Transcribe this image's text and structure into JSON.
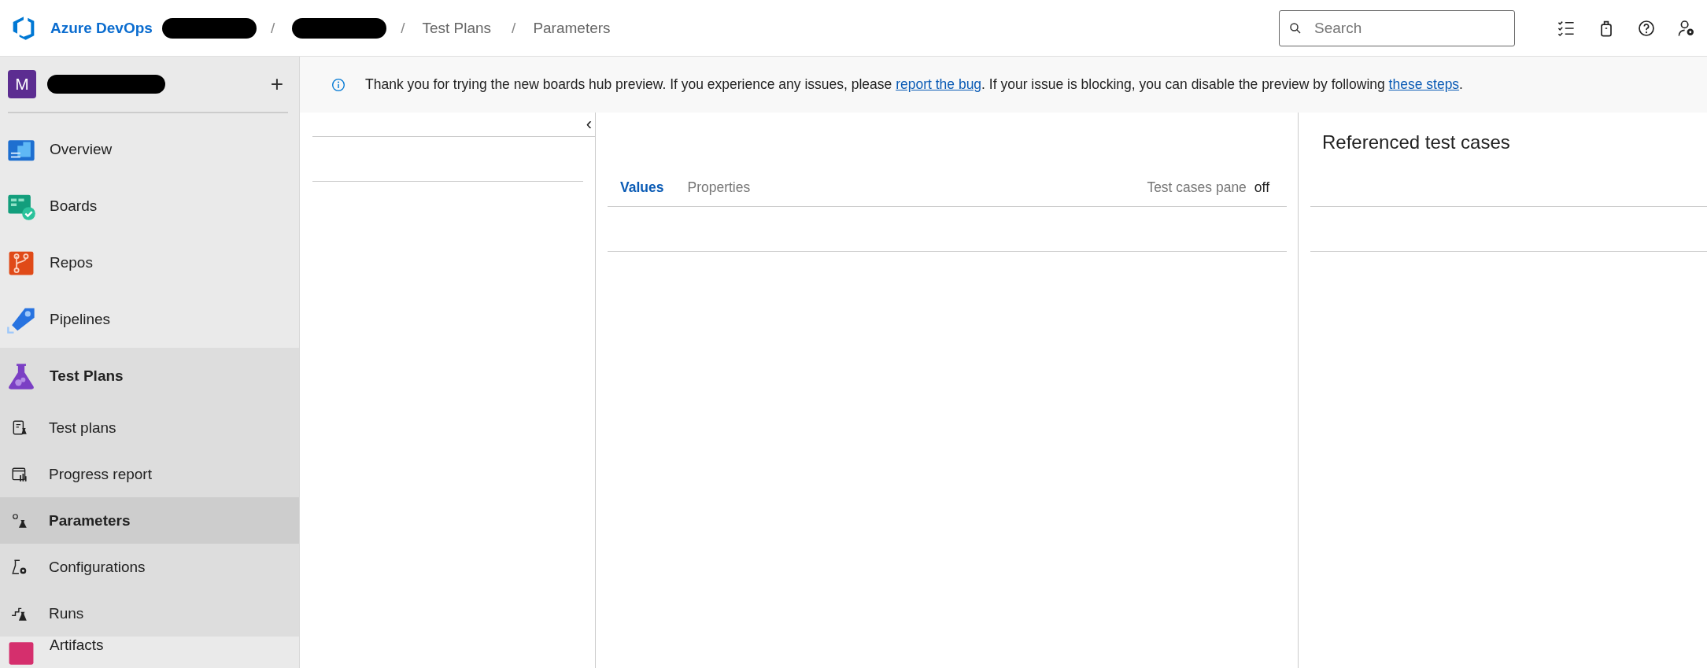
{
  "header": {
    "product": "Azure DevOps",
    "breadcrumbs": [
      {
        "kind": "redacted",
        "separator": "/"
      },
      {
        "kind": "redacted",
        "separator": "/"
      },
      {
        "kind": "text",
        "label": "Test Plans",
        "separator": "/"
      },
      {
        "kind": "text",
        "label": "Parameters"
      }
    ],
    "search": {
      "placeholder": "Search"
    }
  },
  "sidebar": {
    "project": {
      "initial": "M",
      "add": "+"
    },
    "items": [
      {
        "label": "Overview",
        "kind": "overview",
        "selected": false
      },
      {
        "label": "Boards",
        "kind": "boards",
        "selected": false
      },
      {
        "label": "Repos",
        "kind": "repos",
        "selected": false
      },
      {
        "label": "Pipelines",
        "kind": "pipelines",
        "selected": false
      },
      {
        "label": "Test Plans",
        "kind": "testplans",
        "selected": true,
        "children": [
          {
            "label": "Test plans",
            "kind": "plans",
            "selected": false
          },
          {
            "label": "Progress report",
            "kind": "report",
            "selected": false
          },
          {
            "label": "Parameters",
            "kind": "params",
            "selected": true
          },
          {
            "label": "Configurations",
            "kind": "config",
            "selected": false
          },
          {
            "label": "Runs",
            "kind": "runs",
            "selected": false
          }
        ]
      },
      {
        "label": "Artifacts",
        "kind": "artifacts",
        "selected": false
      }
    ]
  },
  "banner": {
    "before": "Thank you for trying the new boards hub preview. If you experience any issues, please ",
    "link_1": "report the bug",
    "middle": ". If your issue is blocking, you can disable the preview by following ",
    "link_2": "these steps",
    "after": "."
  },
  "left_pane": {
    "collapse": "‹"
  },
  "middle_pane": {
    "tabs": [
      {
        "label": "Values",
        "selected": true
      },
      {
        "label": "Properties",
        "selected": false
      }
    ],
    "toggle": {
      "label": "Test cases pane",
      "value": "off"
    }
  },
  "right_pane": {
    "title": "Referenced test cases"
  }
}
